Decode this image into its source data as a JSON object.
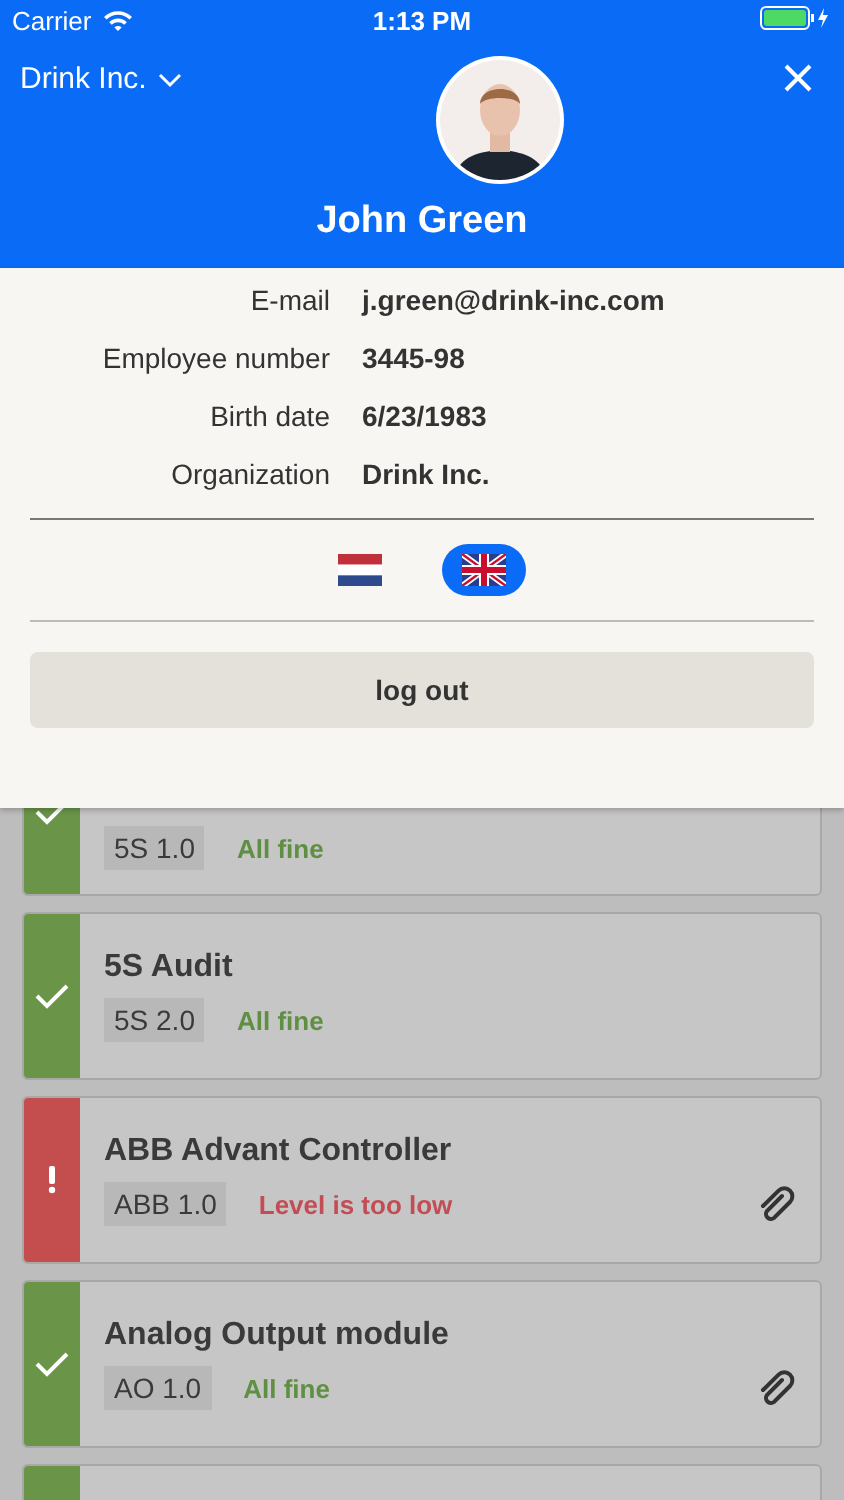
{
  "status_bar": {
    "carrier": "Carrier",
    "time": "1:13 PM"
  },
  "header": {
    "organization": "Drink Inc.",
    "name": "John Green"
  },
  "details": [
    {
      "label": "E-mail",
      "value": "j.green@drink-inc.com"
    },
    {
      "label": "Employee number",
      "value": "3445-98"
    },
    {
      "label": "Birth date",
      "value": "6/23/1983"
    },
    {
      "label": "Organization",
      "value": "Drink Inc."
    }
  ],
  "languages": [
    {
      "kind": "nl",
      "selected": false
    },
    {
      "kind": "gb",
      "selected": true
    }
  ],
  "logout_button": "log out",
  "cards": [
    {
      "kind": "ok",
      "code": "5S 1.0",
      "message": "All fine",
      "attachment": false
    },
    {
      "kind": "ok",
      "title": "5S Audit",
      "code": "5S 2.0",
      "message": "All fine",
      "attachment": false
    },
    {
      "kind": "error",
      "title": "ABB Advant Controller",
      "code": "ABB 1.0",
      "message": "Level is too low",
      "attachment": true
    },
    {
      "kind": "ok",
      "title": "Analog Output module",
      "code": "AO 1.0",
      "message": "All fine",
      "attachment": true
    },
    {
      "kind": "ok"
    }
  ]
}
